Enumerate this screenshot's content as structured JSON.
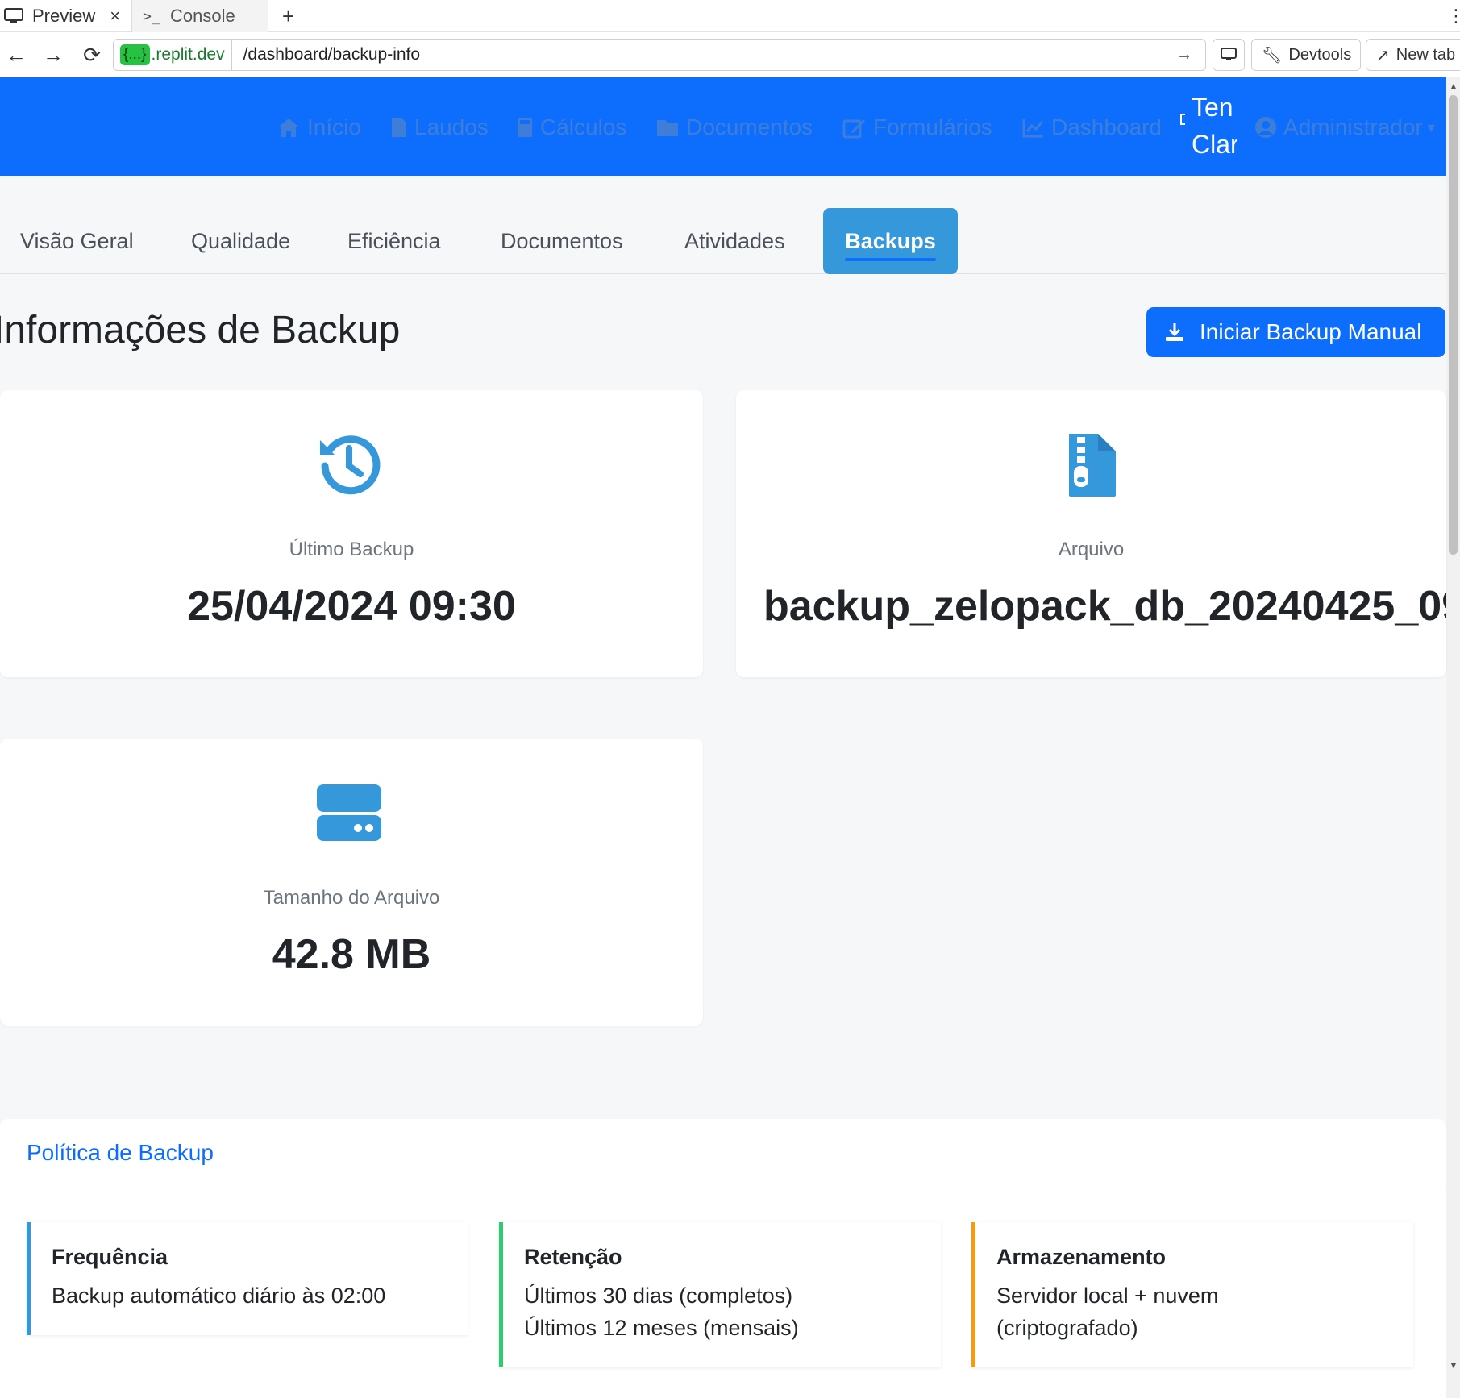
{
  "browser": {
    "tabs": [
      {
        "label": "Preview",
        "icon": "monitor-icon"
      },
      {
        "label": "Console",
        "icon": "terminal-icon"
      }
    ],
    "new_tab_symbol": "+",
    "url_badge": "{...}",
    "url_host": ".replit.dev",
    "url_path": "/dashboard/backup-info",
    "devtools_label": "Devtools",
    "newtab_label": "New tab"
  },
  "navbar": {
    "items": [
      {
        "label": "Início",
        "icon": "home-icon"
      },
      {
        "label": "Laudos",
        "icon": "file-icon"
      },
      {
        "label": "Cálculos",
        "icon": "calculator-icon"
      },
      {
        "label": "Documentos",
        "icon": "folder-icon"
      },
      {
        "label": "Formulários",
        "icon": "edit-icon"
      },
      {
        "label": "Dashboard",
        "icon": "chart-line-icon"
      }
    ],
    "theme_line1": "Ten",
    "theme_line2": "Clar",
    "user_label": "Administrador"
  },
  "tabs": [
    "Visão Geral",
    "Qualidade",
    "Eficiência",
    "Documentos",
    "Atividades",
    "Backups"
  ],
  "active_tab": "Backups",
  "page_title": "Informações de Backup",
  "manual_backup_button": "Iniciar Backup Manual",
  "cards": {
    "last_backup": {
      "label": "Último Backup",
      "value": "25/04/2024 09:30",
      "icon": "history-icon"
    },
    "file": {
      "label": "Arquivo",
      "value": "backup_zelopack_db_20240425_09",
      "icon": "file-zipper-icon"
    },
    "size": {
      "label": "Tamanho do Arquivo",
      "value": "42.8 MB",
      "icon": "hard-drive-icon"
    }
  },
  "policy": {
    "title": "Política de Backup",
    "items": [
      {
        "title": "Frequência",
        "lines": [
          "Backup automático diário às 02:00"
        ],
        "color": "#3498db"
      },
      {
        "title": "Retenção",
        "lines": [
          "Últimos 30 dias (completos)",
          "Últimos 12 meses (mensais)"
        ],
        "color": "#2ecc71"
      },
      {
        "title": "Armazenamento",
        "lines": [
          "Servidor local + nuvem",
          "(criptografado)"
        ],
        "color": "#f39c12"
      }
    ]
  },
  "colors": {
    "primary": "#0d6efd",
    "accent": "#3498db",
    "icon_blue": "#3498db"
  }
}
